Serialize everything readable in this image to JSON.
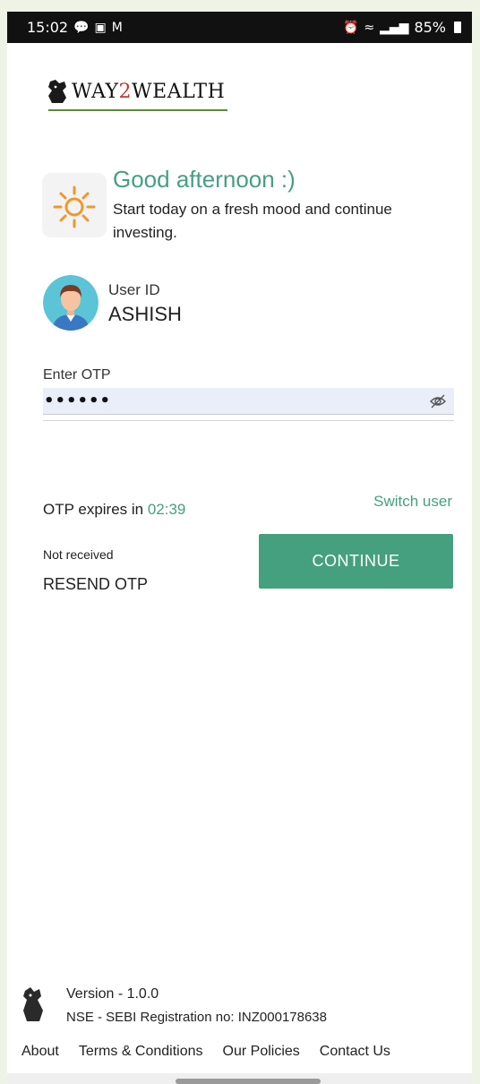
{
  "statusbar": {
    "time": "15:02",
    "battery": "85%",
    "left_icons": [
      "chat-icon",
      "gallery-icon",
      "gmail-icon"
    ],
    "right_icons": [
      "alarm-icon",
      "wifi-icon",
      "wifi-call-icon",
      "signal-icon",
      "volte-icon",
      "signal-icon-2"
    ]
  },
  "brand": {
    "logo_text_a": "WAY",
    "logo_text_b": "2",
    "logo_text_c": "WEALTH"
  },
  "greeting": {
    "title": "Good afternoon :)",
    "subtitle": "Start today on a fresh mood and continue investing.",
    "icon": "sun-icon"
  },
  "user": {
    "label": "User ID",
    "value": "ASHISH"
  },
  "otp": {
    "label": "Enter OTP",
    "masked_value": "••••••",
    "expires_label": "OTP expires in ",
    "expires_time": "02:39"
  },
  "actions": {
    "switch_user": "Switch user",
    "not_received": "Not received",
    "resend": "RESEND OTP",
    "continue": "CONTINUE"
  },
  "footer": {
    "version": "Version - 1.0.0",
    "sebi": "NSE - SEBI Registration no: INZ000178638",
    "links": [
      "About",
      "Terms & Conditions",
      "Our Policies",
      "Contact Us"
    ]
  },
  "colors": {
    "accent": "#45a07f",
    "statusbar": "#111111",
    "otp_field_bg": "#e9eef9",
    "brand_red": "#c0392b",
    "brand_green": "#5a8a3a"
  }
}
